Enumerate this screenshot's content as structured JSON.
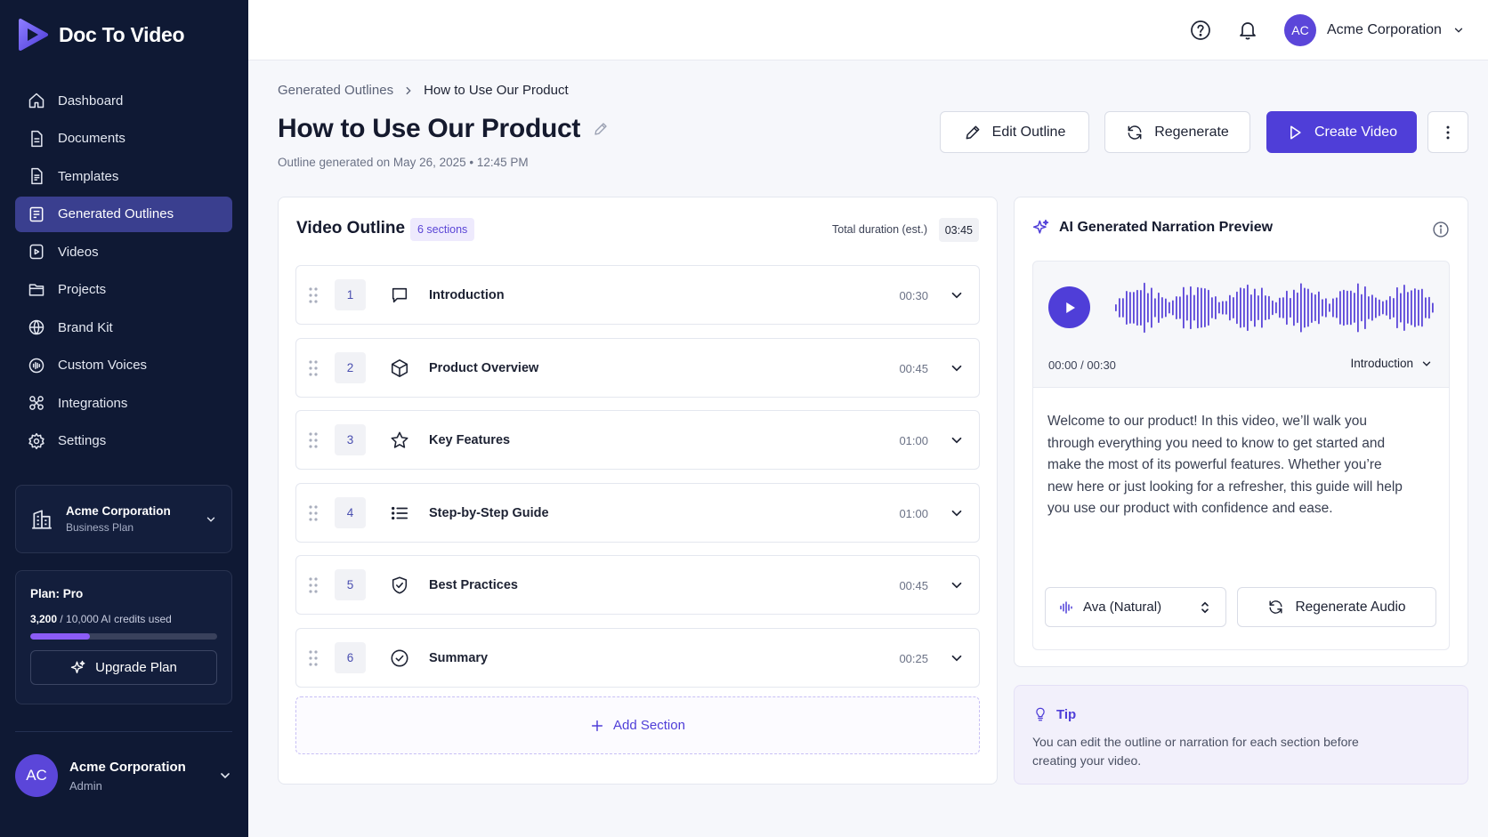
{
  "brand": {
    "name": "Doc To Video"
  },
  "sidebar": {
    "items": [
      {
        "label": "Dashboard",
        "icon": "home-icon"
      },
      {
        "label": "Documents",
        "icon": "document-icon"
      },
      {
        "label": "Templates",
        "icon": "template-icon"
      },
      {
        "label": "Generated Outlines",
        "icon": "outline-icon",
        "active": true
      },
      {
        "label": "Videos",
        "icon": "video-icon"
      },
      {
        "label": "Projects",
        "icon": "folder-icon"
      },
      {
        "label": "Brand Kit",
        "icon": "globe-icon"
      },
      {
        "label": "Custom Voices",
        "icon": "voice-icon"
      },
      {
        "label": "Integrations",
        "icon": "integrations-icon"
      },
      {
        "label": "Settings",
        "icon": "gear-icon"
      }
    ],
    "org": {
      "name": "Acme Corporation",
      "plan": "Business Plan"
    },
    "plan": {
      "title": "Plan: Pro",
      "used": "3,200",
      "total": "/ 10,000 AI credits used",
      "used_fraction": 0.32,
      "upgrade_label": "Upgrade Plan"
    },
    "user": {
      "initials": "AC",
      "name": "Acme Corporation",
      "role": "Admin"
    }
  },
  "topbar": {
    "user_initials": "AC",
    "user_name": "Acme Corporation"
  },
  "breadcrumb": {
    "parent": "Generated Outlines",
    "current": "How to Use Our Product"
  },
  "page": {
    "title": "How to Use Our Product",
    "generated_meta": "Outline generated on May 26, 2025  •  12:45 PM",
    "edit_label": "Edit Outline",
    "regenerate_label": "Regenerate",
    "create_label": "Create Video"
  },
  "outline": {
    "title": "Video Outline",
    "sections_badge": "6 sections",
    "duration_label": "Total duration (est.)",
    "duration_value": "03:45",
    "sections": [
      {
        "num": "1",
        "title": "Introduction",
        "time": "00:30",
        "icon": "chat-icon"
      },
      {
        "num": "2",
        "title": "Product Overview",
        "time": "00:45",
        "icon": "box-icon"
      },
      {
        "num": "3",
        "title": "Key Features",
        "time": "01:00",
        "icon": "star-icon"
      },
      {
        "num": "4",
        "title": "Step-by-Step Guide",
        "time": "01:00",
        "icon": "list-icon"
      },
      {
        "num": "5",
        "title": "Best Practices",
        "time": "00:45",
        "icon": "shield-check-icon"
      },
      {
        "num": "6",
        "title": "Summary",
        "time": "00:25",
        "icon": "check-circle-icon"
      }
    ],
    "add_label": "Add Section"
  },
  "narration": {
    "title": "AI Generated Narration Preview",
    "time": "00:00 / 00:30",
    "section": "Introduction",
    "script": "Welcome to our product! In this video, we’ll walk you through everything you need to know to get started and make the most of its powerful features. Whether you’re new here or just looking for a refresher, this guide will help you use our product with confidence and ease.",
    "voice": "Ava (Natural)",
    "regen_audio_label": "Regenerate Audio"
  },
  "tip": {
    "title": "Tip",
    "text": "You can edit the outline or narration for each section before creating your video."
  },
  "colors": {
    "sidebar_bg": "#0f1934",
    "accent": "#4f3ed8",
    "active_nav": "#3a3f8f",
    "progress": "#8b5cf6"
  }
}
